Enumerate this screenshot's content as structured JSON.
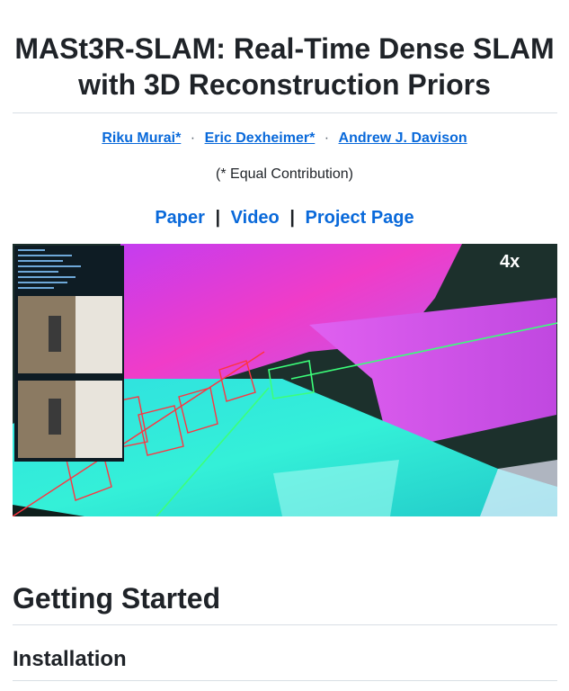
{
  "title_line1": "MASt3R-SLAM: Real-Time Dense SLAM",
  "title_line2": "with 3D Reconstruction Priors",
  "authors": [
    {
      "name": "Riku Murai*"
    },
    {
      "name": "Eric Dexheimer*"
    },
    {
      "name": "Andrew J. Davison"
    }
  ],
  "author_separator": "·",
  "contribution_note": "(* Equal Contribution)",
  "links": {
    "paper": "Paper",
    "video": "Video",
    "project_page": "Project Page",
    "separator": "|"
  },
  "hero_image": {
    "speed_badge": "4x"
  },
  "sections": {
    "getting_started": "Getting Started",
    "installation": "Installation"
  }
}
